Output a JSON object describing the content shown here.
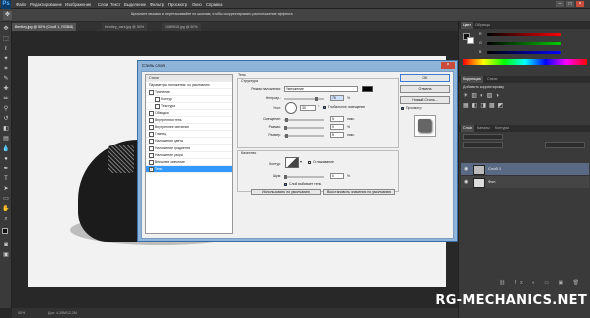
{
  "app": {
    "logo": "Ps"
  },
  "menubar": {
    "items": [
      "Файл",
      "Редактирование",
      "Изображение",
      "Слои",
      "Текст",
      "Выделение",
      "Фильтр",
      "Просмотр",
      "Окно",
      "Справка"
    ]
  },
  "optionsbar": {
    "hint": "Щелкните мышью и перетаскивайте по шкалам, чтобы скорректировать расположение эффекта."
  },
  "tabs": [
    {
      "label": "Bentley.jpg @ 50% (Слой 1, RGB/8)"
    },
    {
      "label": "bentley_cars.jpg @ 50%"
    },
    {
      "label": "1089915.jpg @ 50%"
    }
  ],
  "statusbar": {
    "zoom": "50%",
    "doc": "Док: 4,39М/12,2M"
  },
  "panels": {
    "color_tabs": [
      "Цвет",
      "Образцы"
    ],
    "color_labels": [
      "R",
      "G",
      "B"
    ],
    "adjust_tabs": [
      "Коррекция",
      "Стили"
    ],
    "adjust_title": "Добавить корректировку",
    "layers_tabs": [
      "Слои",
      "Каналы",
      "Контуры"
    ],
    "layers": [
      {
        "name": "Слой 1",
        "selected": true
      },
      {
        "name": "Фон",
        "selected": false
      }
    ]
  },
  "dialog": {
    "title": "Стиль слоя",
    "styles": [
      {
        "label": "Стили",
        "checked": false,
        "header": true
      },
      {
        "label": "Параметры наложения: по умолчанию",
        "checked": false,
        "header": true
      },
      {
        "label": "Тиснение",
        "checked": false
      },
      {
        "label": "Контур",
        "checked": false,
        "indent": true
      },
      {
        "label": "Текстура",
        "checked": false,
        "indent": true
      },
      {
        "label": "Обводка",
        "checked": false
      },
      {
        "label": "Внутренняя тень",
        "checked": false
      },
      {
        "label": "Внутреннее свечение",
        "checked": false
      },
      {
        "label": "Глянец",
        "checked": false
      },
      {
        "label": "Наложение цвета",
        "checked": false
      },
      {
        "label": "Наложение градиента",
        "checked": false
      },
      {
        "label": "Наложение узора",
        "checked": false
      },
      {
        "label": "Внешнее свечение",
        "checked": false
      },
      {
        "label": "Тень",
        "checked": true,
        "selected": true
      }
    ],
    "section_title": "Тень",
    "structure_title": "Структура",
    "blend_mode_label": "Режим наложения:",
    "blend_mode_value": "Умножение",
    "opacity_label": "Непрозр.:",
    "opacity_value": "75",
    "angle_label": "Угол:",
    "angle_value": "30",
    "global_light_label": "Глобальное освещение",
    "distance_label": "Смещение:",
    "distance_value": "5",
    "spread_label": "Размах:",
    "spread_value": "0",
    "size_label": "Размер:",
    "size_value": "5",
    "unit_px": "пикс.",
    "unit_pct": "%",
    "deg": "°",
    "quality_title": "Качество",
    "contour_label": "Контур:",
    "antialias_label": "Сглаживание",
    "noise_label": "Шум:",
    "noise_value": "0",
    "knockout_label": "Слой выбивает тень",
    "make_default": "Использовать по умолчанию",
    "reset_default": "Восстановить значения по умолчанию",
    "ok": "OK",
    "cancel": "Отмена",
    "new_style": "Новый Стиль...",
    "preview_label": "Просмотр"
  },
  "watermark": "RG-MECHANICS.NET"
}
